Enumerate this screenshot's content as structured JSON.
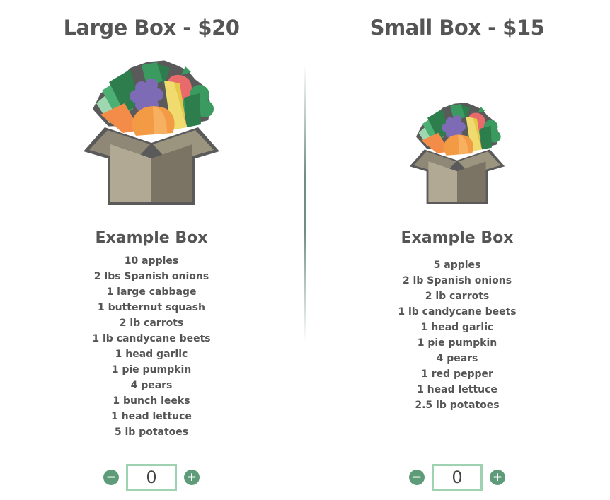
{
  "products": [
    {
      "title": "Large Box - $20",
      "example_title": "Example Box",
      "items": [
        "10 apples",
        "2 lbs Spanish onions",
        "1 large cabbage",
        "1 butternut squash",
        "2 lb carrots",
        "1 lb candycane beets",
        "1 head garlic",
        "1 pie pumpkin",
        "4 pears",
        "1 bunch leeks",
        "1 head lettuce",
        "5 lb potatoes"
      ],
      "quantity": "0",
      "minus_label": "−",
      "plus_label": "+",
      "illustration_icon": "produce-box-icon"
    },
    {
      "title": "Small Box - $15",
      "example_title": "Example Box",
      "items": [
        "5 apples",
        "2 lb Spanish onions",
        "2 lb carrots",
        "1 lb candycane beets",
        "1 head garlic",
        "1 pie pumpkin",
        "4 pears",
        "1 red pepper",
        "1 head lettuce",
        "2.5 lb potatoes"
      ],
      "quantity": "0",
      "minus_label": "−",
      "plus_label": "+",
      "illustration_icon": "produce-box-icon"
    }
  ],
  "colors": {
    "text": "#555555",
    "button_green": "#5e9b78",
    "input_border": "#9fd2b1",
    "box_light": "#b1a994",
    "box_dark": "#7b7465",
    "box_outline": "#5a5a5a"
  }
}
